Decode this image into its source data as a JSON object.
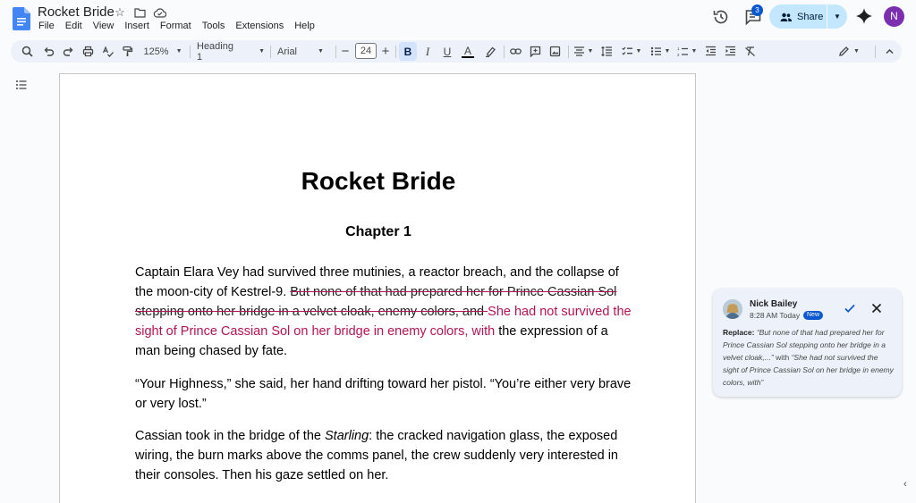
{
  "app": {
    "doc_title": "Rocket Bride",
    "menu": [
      "File",
      "Edit",
      "View",
      "Insert",
      "Format",
      "Tools",
      "Extensions",
      "Help"
    ],
    "comments_count": "3",
    "share_label": "Share",
    "avatar_initial": "N"
  },
  "toolbar": {
    "zoom": "125%",
    "style": "Heading 1",
    "font": "Arial",
    "font_size": "24",
    "bold_label": "B"
  },
  "document": {
    "title": "Rocket Bride",
    "chapter": "Chapter 1",
    "p1": {
      "plain_start": "Captain Elara Vey had survived three mutinies, a reactor breach, and the collapse of the moon-city of Kestrel-9. ",
      "deleted": "But none of that had prepared her for Prince Cassian Sol stepping onto her bridge in a velvet cloak, enemy colors, and ",
      "inserted": "She had not survived the sight of Prince Cassian Sol on her bridge in enemy colors, with",
      "plain_end": " the expression of a man being chased by fate."
    },
    "p2": "“Your Highness,” she said, her hand drifting toward her pistol. “You’re either very brave or very lost.”",
    "p3": {
      "before": "Cassian took in the bridge of the ",
      "ship": "Starling",
      "after": ": the cracked navigation glass, the exposed wiring, the burn marks above the comms panel, the crew suddenly very interested in their consoles. Then his gaze settled on her."
    }
  },
  "comment": {
    "author": "Nick Bailey",
    "time": "8:28 AM Today",
    "badge": "New",
    "label": "Replace:",
    "old_text": "“But none of that had prepared her for Prince Cassian Sol stepping onto her bridge in a velvet cloak,...”",
    "with_word": "with",
    "new_text": "“She had not survived the sight of Prince Cassian Sol on her bridge in enemy colors, with”"
  },
  "colors": {
    "accent": "#0b57d0",
    "share_bg": "#c2e7ff",
    "suggestion": "#b31455",
    "toolbar_bg": "#edf2fa",
    "avatar": "#7b2fb0"
  }
}
